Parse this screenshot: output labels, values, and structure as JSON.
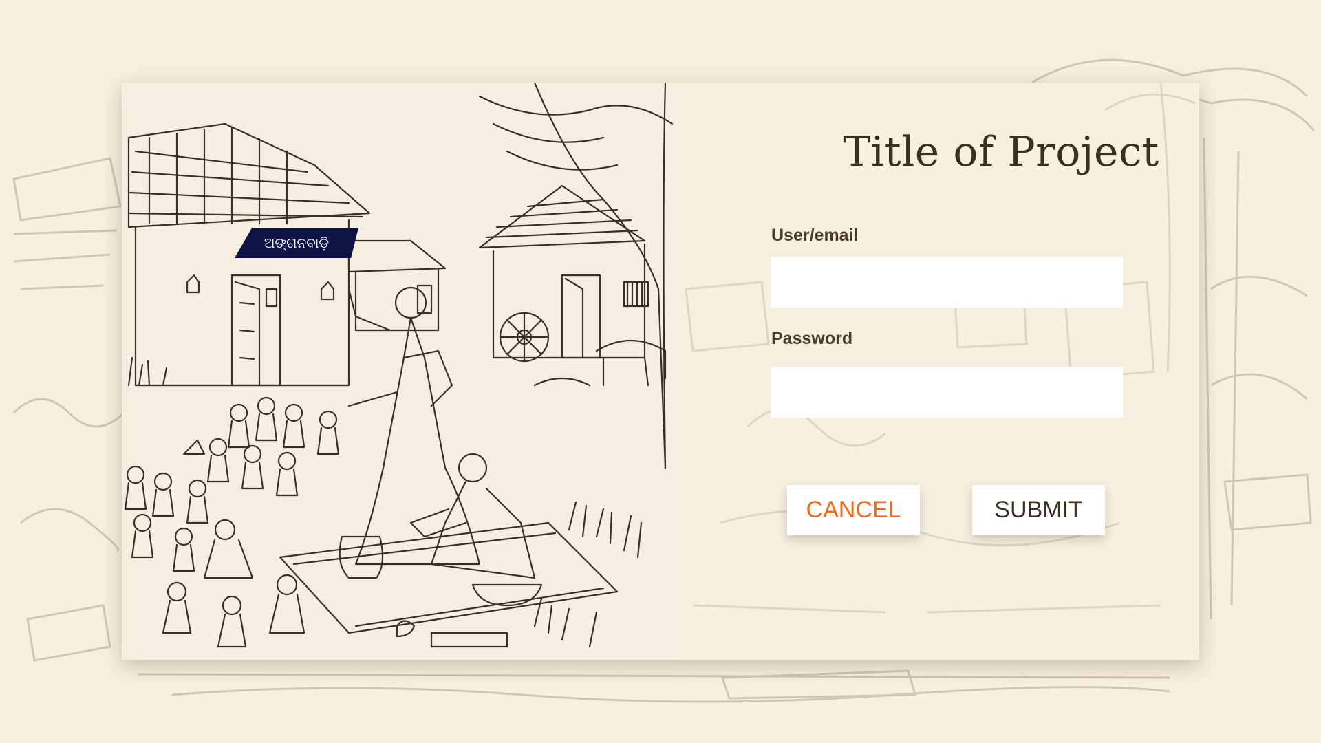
{
  "page": {
    "title": "Title of Project"
  },
  "illustration": {
    "sign_text": "ଅଙ୍ଗନବାଡ଼ି"
  },
  "form": {
    "user_label": "User/email",
    "user_value": "",
    "user_placeholder": "",
    "password_label": "Password",
    "password_value": "",
    "password_placeholder": ""
  },
  "buttons": {
    "cancel_label": "CANCEL",
    "submit_label": "SUBMIT"
  },
  "colors": {
    "background": "#f7efe0",
    "cancel_text": "#f06a1a",
    "sign_background": "#0d1445",
    "title_text": "#3a2f22"
  }
}
